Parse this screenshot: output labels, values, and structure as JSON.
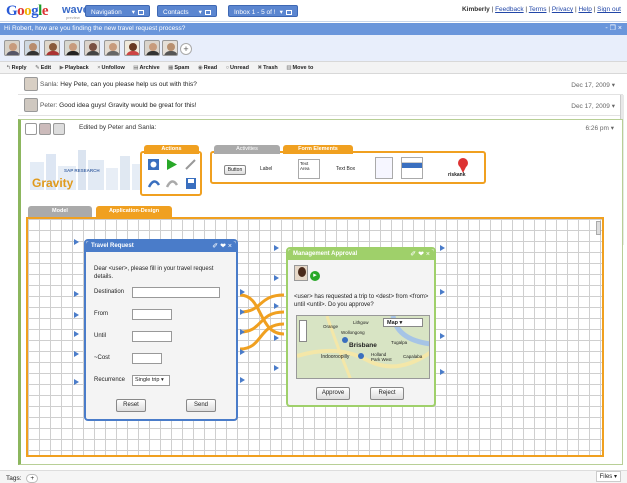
{
  "app": {
    "logo_letters": [
      "G",
      "o",
      "o",
      "g",
      "l",
      "e"
    ],
    "logo_product": "wave",
    "logo_sub": "preview"
  },
  "nav": {
    "buttons": [
      "Navigation",
      "Contacts",
      "Inbox 1 - 5 of !"
    ]
  },
  "user": {
    "name": "Kimberly",
    "links": [
      "Feedback",
      "Terms",
      "Privacy",
      "Help",
      "Sign out"
    ]
  },
  "wave": {
    "title": "Hi Robert, how are you finding the new travel request process?",
    "controls": "- ❐ ×",
    "add_participant": "+"
  },
  "toolbar": {
    "items": [
      {
        "icon": "reply-icon",
        "glyph": "↰",
        "label": "Reply"
      },
      {
        "icon": "edit-icon",
        "glyph": "✎",
        "label": "Edit"
      },
      {
        "icon": "playback-icon",
        "glyph": "▶",
        "label": "Playback"
      },
      {
        "icon": "unfollow-icon",
        "glyph": "×",
        "label": "Unfollow"
      },
      {
        "icon": "archive-icon",
        "glyph": "▤",
        "label": "Archive"
      },
      {
        "icon": "spam-icon",
        "glyph": "▦",
        "label": "Spam"
      },
      {
        "icon": "read-icon",
        "glyph": "◉",
        "label": "Read"
      },
      {
        "icon": "unread-icon",
        "glyph": "○",
        "label": "Unread"
      },
      {
        "icon": "trash-icon",
        "glyph": "✖",
        "label": "Trash"
      },
      {
        "icon": "move-to-icon",
        "glyph": "▥",
        "label": "Move to"
      }
    ]
  },
  "blips": [
    {
      "author": "Sanla:",
      "text": "Hey Pete, can you please help us out with this?",
      "date": "Dec 17, 2009 ▾"
    },
    {
      "author": "Peter:",
      "text": "Good idea guys! Gravity would be great for this!",
      "date": "Dec 17, 2009 ▾"
    }
  ],
  "edit_blip": {
    "header": "Edited by Peter and Sanla:",
    "time": "6:26 pm ▾"
  },
  "gravity": {
    "logo": "Gravity",
    "sap": "SAP RESEARCH"
  },
  "panels": {
    "actions": "Actions",
    "activities": "Activities",
    "form_elements": "Form Elements",
    "elements": {
      "button": "Button",
      "label": "Label",
      "text_area": "Text Area",
      "text_box": "Text Box",
      "risk": "riskank"
    }
  },
  "canvas_tabs": {
    "model": "Model",
    "design": "Application-Design"
  },
  "travel_request": {
    "title": "Travel Request",
    "title_controls": "✐ ❤ ×",
    "intro": "Dear <user>, please fill in your travel request details.",
    "fields": [
      "Destination",
      "From",
      "Until",
      "~Cost"
    ],
    "recurrence_label": "Recurrence",
    "recurrence_value": "Single trip ▾",
    "reset": "Reset",
    "send": "Send"
  },
  "approval": {
    "title": "Management Approval",
    "title_controls": "✐ ❤ ×",
    "text": "<user> has requested a trip to <dest> from <from> until <until>. Do you approve?",
    "map_type": "Map",
    "map_labels": [
      "Orange",
      "Lithgow",
      "Wollongong",
      "Brisbane",
      "Indooroopilly",
      "Holland Park West",
      "Capalaba",
      "Tugalpa"
    ],
    "approve": "Approve",
    "reject": "Reject"
  },
  "tags": {
    "label": "Tags:",
    "add": "+"
  },
  "files": "Files ▾",
  "colors": {
    "wave_header": "#6a96db",
    "orange": "#f0a020",
    "node_blue": "#4a7cc9",
    "node_green": "#9fd06a"
  }
}
